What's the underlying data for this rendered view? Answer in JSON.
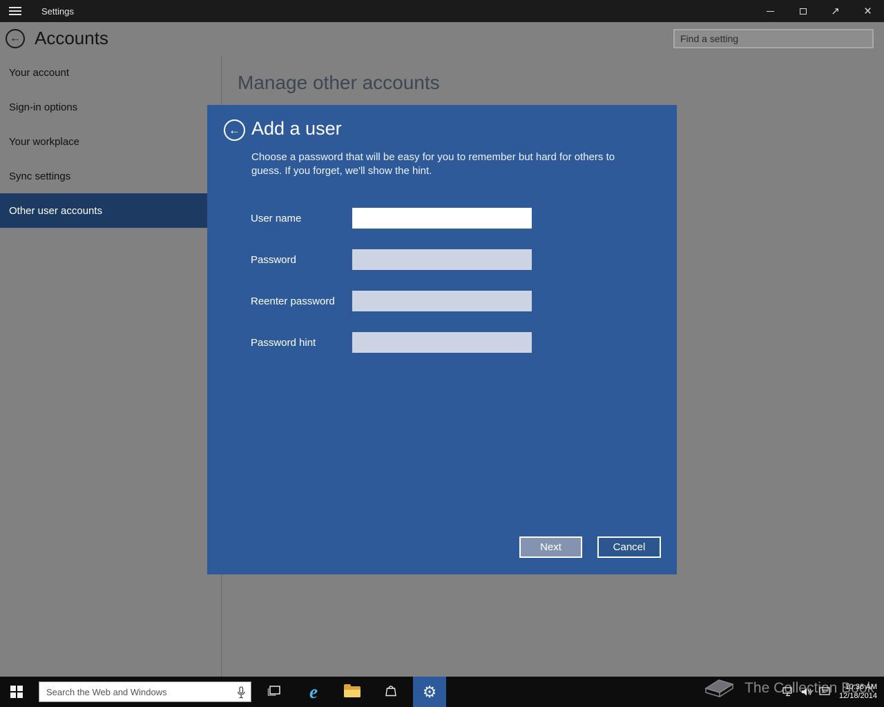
{
  "titlebar": {
    "app_title": "Settings"
  },
  "header": {
    "page_title": "Accounts",
    "search_placeholder": "Find a setting"
  },
  "sidebar": {
    "items": [
      {
        "label": "Your account",
        "selected": false
      },
      {
        "label": "Sign-in options",
        "selected": false
      },
      {
        "label": "Your workplace",
        "selected": false
      },
      {
        "label": "Sync settings",
        "selected": false
      },
      {
        "label": "Other user accounts",
        "selected": true
      }
    ]
  },
  "main": {
    "heading": "Manage other accounts"
  },
  "dialog": {
    "title": "Add a user",
    "description": "Choose a password that will be easy for you to remember but hard for others to guess. If you forget, we'll show the hint.",
    "fields": [
      {
        "label": "User name",
        "value": "",
        "focused": true
      },
      {
        "label": "Password",
        "value": "",
        "focused": false
      },
      {
        "label": "Reenter password",
        "value": "",
        "focused": false
      },
      {
        "label": "Password hint",
        "value": "",
        "focused": false
      }
    ],
    "next_label": "Next",
    "cancel_label": "Cancel"
  },
  "taskbar": {
    "search_placeholder": "Search the Web and Windows",
    "tray": {
      "time": "10:36 AM",
      "date": "12/18/2014"
    }
  },
  "watermark": {
    "text": "The Collection Book"
  },
  "icons": {
    "back": "←",
    "close": "×",
    "fullscreen": "↗",
    "gear": "⚙",
    "ie": "e"
  },
  "colors": {
    "dialog_blue": "#2e5a99",
    "selected_item_navy": "#1d3b62",
    "background_gray": "#818181",
    "taskbar_black": "#0d0d0d",
    "input_tint": "#ccd3e2",
    "next_button": "#8494b0"
  }
}
